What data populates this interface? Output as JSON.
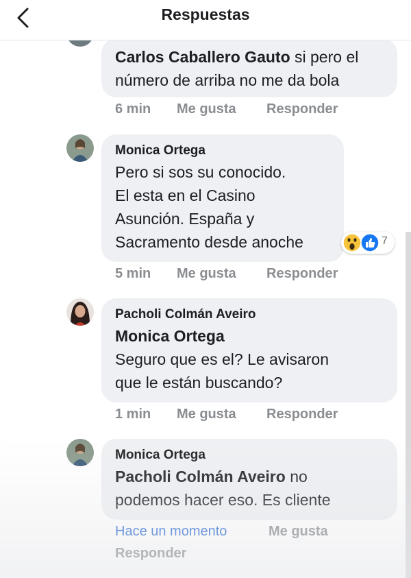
{
  "header": {
    "title": "Respuestas"
  },
  "comments": [
    {
      "mention": "Carlos Caballero Gauto",
      "line1_rest": " si pero el",
      "line2": "número de arriba no me da bola",
      "time": "6 min",
      "like": "Me gusta",
      "reply": "Responder"
    },
    {
      "author": "Monica Ortega",
      "lines": [
        "Pero si sos su conocido.",
        "El esta en el Casino",
        "Asunción. España y",
        "Sacramento desde anoche"
      ],
      "reactions": {
        "icons": [
          "wow-emoji",
          "like-emoji"
        ],
        "count": "7"
      },
      "time": "5 min",
      "like": "Me gusta",
      "reply": "Responder"
    },
    {
      "author": "Pacholi Colmán Aveiro",
      "mention": "Monica Ortega",
      "lines": [
        "Seguro que es el? Le avisaron",
        "que le están buscando?"
      ],
      "time": "1 min",
      "like": "Me gusta",
      "reply": "Responder"
    },
    {
      "author": "Monica Ortega",
      "mention": "Pacholi Colmán Aveiro",
      "line1_rest": " no",
      "line2": "podemos hacer eso. Es cliente",
      "time": "Hace un momento",
      "like": "Me gusta",
      "reply": "Responder"
    }
  ],
  "colors": {
    "link": "#2d6bd6",
    "meta": "#8a8d91",
    "bubble": "#eef0f3"
  }
}
